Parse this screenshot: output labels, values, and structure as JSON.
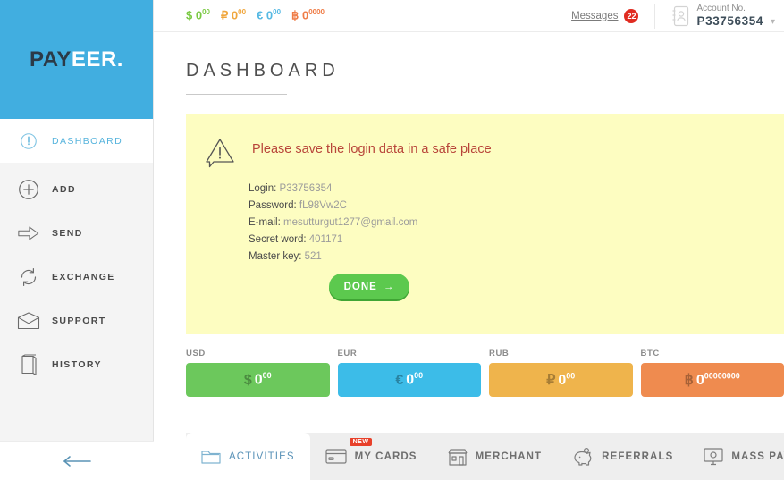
{
  "brand": {
    "part1": "PAY",
    "part2": "EER",
    "dot": "."
  },
  "topbar": {
    "balances": [
      {
        "name": "usd-balance",
        "symbol": "$",
        "whole": "0",
        "cents": "00",
        "color": "#7ac943"
      },
      {
        "name": "rub-balance",
        "symbol": "₽",
        "whole": "0",
        "cents": "00",
        "color": "#f0a63c"
      },
      {
        "name": "eur-balance",
        "symbol": "€",
        "whole": "0",
        "cents": "00",
        "color": "#56b9e3"
      },
      {
        "name": "btc-balance",
        "symbol": "฿",
        "whole": "0",
        "cents": "0000",
        "color": "#ef7b45"
      }
    ],
    "messages_label": "Messages",
    "messages_count": "22",
    "account_label": "Account No.",
    "account_number": "P33756354"
  },
  "page": {
    "title": "DASHBOARD"
  },
  "sidebar": {
    "items": [
      {
        "label": "DASHBOARD",
        "icon": "gauge-icon",
        "active": true
      },
      {
        "label": "ADD",
        "icon": "plus-circle-icon",
        "active": false
      },
      {
        "label": "SEND",
        "icon": "arrow-right-icon",
        "active": false
      },
      {
        "label": "EXCHANGE",
        "icon": "refresh-icon",
        "active": false
      },
      {
        "label": "SUPPORT",
        "icon": "envelope-icon",
        "active": false
      },
      {
        "label": "HISTORY",
        "icon": "book-icon",
        "active": false
      }
    ],
    "collapse_icon": "arrow-left-icon"
  },
  "notice": {
    "icon": "warning-bubble-icon",
    "title": "Please save the login data in a safe place",
    "credentials": [
      {
        "label": "Login:",
        "value": "P33756354"
      },
      {
        "label": "Password:",
        "value": "fL98Vw2C"
      },
      {
        "label": "E-mail:",
        "value": "mesutturgut1277@gmail.com"
      },
      {
        "label": "Secret word:",
        "value": "401171"
      },
      {
        "label": "Master key:",
        "value": "521"
      }
    ],
    "done_label": "DONE",
    "done_arrow": "→"
  },
  "cards": [
    {
      "label": "USD",
      "symbol": "$",
      "whole": "0",
      "decimals": "00",
      "color": "#6cc85c"
    },
    {
      "label": "EUR",
      "symbol": "€",
      "whole": "0",
      "decimals": "00",
      "color": "#3cbce8"
    },
    {
      "label": "RUB",
      "symbol": "₽",
      "whole": "0",
      "decimals": "00",
      "color": "#efb košu"
    },
    {
      "label": "BTC",
      "symbol": "฿",
      "whole": "0",
      "decimals": "00000000",
      "color": "#ef8b4f"
    }
  ],
  "tabs": [
    {
      "label": "ACTIVITIES",
      "icon": "folder-icon",
      "active": true,
      "badge": ""
    },
    {
      "label": "MY CARDS",
      "icon": "credit-card-icon",
      "active": false,
      "badge": "NEW"
    },
    {
      "label": "MERCHANT",
      "icon": "shop-icon",
      "active": false,
      "badge": ""
    },
    {
      "label": "REFERRALS",
      "icon": "piggy-bank-icon",
      "active": false,
      "badge": ""
    },
    {
      "label": "MASS PAYMENT",
      "icon": "monitor-icon",
      "active": false,
      "badge": ""
    }
  ]
}
